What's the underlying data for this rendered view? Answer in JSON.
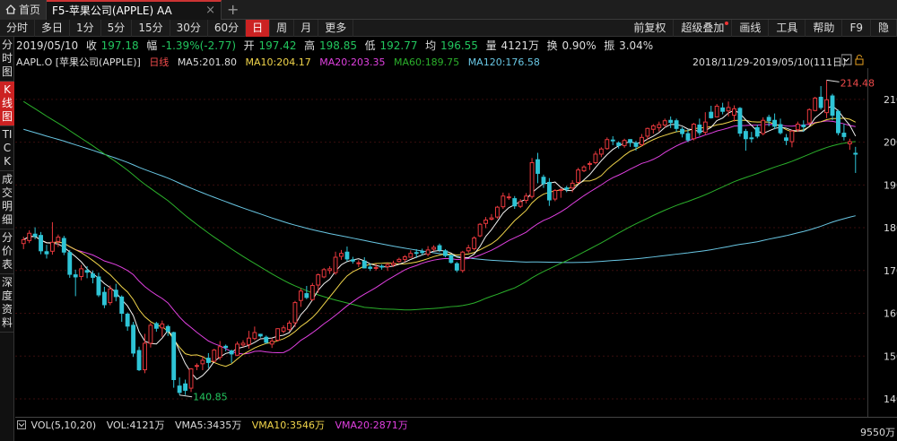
{
  "tabs": {
    "home": "首页",
    "active": "F5-苹果公司(APPLE) AA",
    "close": "×",
    "add": "+"
  },
  "toolbar": {
    "periods": [
      "分时",
      "多日",
      "1分",
      "5分",
      "15分",
      "30分",
      "60分",
      "日",
      "周",
      "月",
      "更多"
    ],
    "active_period": "日",
    "right": [
      "前复权",
      "超级叠加",
      "画线",
      "工具",
      "帮助",
      "F9",
      "隐"
    ]
  },
  "left_tabs": [
    "分时图",
    "K线图",
    "TICK",
    "成交明细",
    "分价表",
    "深度资料"
  ],
  "active_left_tab": "K线图",
  "quote": {
    "date": "2019/05/10",
    "close_label": "收",
    "close": "197.18",
    "change_label": "幅",
    "change": "-1.39%(-2.77)",
    "open_label": "开",
    "open": "197.42",
    "high_label": "高",
    "high": "198.85",
    "low_label": "低",
    "low": "192.77",
    "avg_label": "均",
    "avg": "196.55",
    "vol_label": "量",
    "vol": "4121万",
    "turnover_label": "换",
    "turnover": "0.90%",
    "amp_label": "振",
    "amp": "3.04%"
  },
  "legend": {
    "symbol": "AAPL.O [苹果公司(APPLE)]",
    "period": "日线",
    "ma5": "MA5:201.80",
    "ma10": "MA10:204.17",
    "ma20": "MA20:203.35",
    "ma60": "MA60:189.75",
    "ma120": "MA120:176.58",
    "range": "2018/11/29-2019/05/10(111日)"
  },
  "colors": {
    "up": "#e8383d",
    "down": "#2ec4d6",
    "ma5": "#f2f2f2",
    "ma10": "#f2d64b",
    "ma20": "#e040e0",
    "ma60": "#2bb02b",
    "ma120": "#69c7e4",
    "grid": "#3a0e0e"
  },
  "chart_data": {
    "type": "candlestick",
    "yticks": [
      140,
      150,
      160,
      170,
      180,
      190,
      200,
      210
    ],
    "ylim": [
      135.6,
      217.3
    ],
    "max_label": "214.48",
    "min_label": "140.85",
    "candles": [
      [
        176.3,
        177.2,
        175.0,
        177.9
      ],
      [
        177.0,
        178.7,
        176.4,
        179.4
      ],
      [
        178.5,
        178.0,
        177.3,
        180.1
      ],
      [
        178.2,
        174.6,
        173.8,
        179.0
      ],
      [
        174.4,
        173.9,
        172.8,
        176.0
      ],
      [
        174.5,
        176.6,
        173.7,
        181.3
      ],
      [
        176.8,
        177.8,
        175.5,
        178.4
      ],
      [
        177.5,
        174.3,
        173.6,
        178.1
      ],
      [
        174.2,
        169.1,
        168.3,
        174.8
      ],
      [
        169.0,
        168.5,
        164.0,
        170.2
      ],
      [
        168.6,
        170.4,
        167.7,
        171.3
      ],
      [
        170.0,
        169.6,
        168.2,
        171.0
      ],
      [
        169.2,
        168.4,
        167.0,
        170.0
      ],
      [
        168.5,
        164.3,
        163.8,
        169.5
      ],
      [
        164.9,
        162.0,
        161.2,
        166.2
      ],
      [
        162.5,
        165.7,
        161.9,
        166.5
      ],
      [
        165.4,
        163.9,
        162.8,
        166.9
      ],
      [
        163.8,
        160.0,
        158.0,
        164.2
      ],
      [
        159.8,
        157.0,
        155.9,
        160.2
      ],
      [
        157.2,
        150.7,
        149.8,
        158.0
      ],
      [
        151.3,
        146.8,
        146.5,
        152.2
      ],
      [
        146.8,
        153.0,
        146.0,
        155.2
      ],
      [
        153.0,
        157.2,
        152.0,
        157.8
      ],
      [
        157.6,
        156.5,
        155.7,
        158.0
      ],
      [
        156.6,
        157.5,
        154.5,
        158.3
      ],
      [
        156.9,
        155.8,
        154.7,
        157.3
      ],
      [
        155.5,
        144.5,
        142.6,
        155.7
      ],
      [
        143.0,
        141.5,
        140.9,
        145.0
      ],
      [
        143.5,
        142.0,
        140.9,
        144.5
      ],
      [
        142.5,
        147.0,
        141.6,
        147.2
      ],
      [
        147.6,
        147.8,
        146.7,
        148.3
      ],
      [
        148.2,
        149.0,
        146.7,
        150.0
      ],
      [
        149.5,
        148.5,
        147.2,
        150.7
      ],
      [
        148.8,
        151.4,
        148.6,
        151.7
      ],
      [
        149.7,
        152.2,
        149.1,
        153.5
      ],
      [
        152.3,
        152.0,
        151.1,
        152.7
      ],
      [
        151.2,
        150.5,
        148.4,
        151.5
      ],
      [
        150.2,
        152.8,
        150.0,
        153.4
      ],
      [
        152.6,
        153.0,
        152.1,
        153.7
      ],
      [
        152.7,
        154.2,
        151.7,
        155.9
      ],
      [
        154.1,
        155.5,
        153.7,
        156.9
      ],
      [
        155.1,
        154.7,
        154.3,
        155.2
      ],
      [
        154.4,
        153.2,
        152.9,
        154.8
      ],
      [
        152.8,
        153.5,
        151.9,
        154.2
      ],
      [
        153.7,
        156.4,
        153.4,
        156.5
      ],
      [
        155.8,
        156.6,
        155.3,
        157.2
      ],
      [
        156.2,
        157.7,
        155.8,
        158.3
      ],
      [
        157.8,
        162.5,
        156.8,
        162.9
      ],
      [
        163.0,
        165.2,
        161.5,
        165.8
      ],
      [
        164.6,
        163.7,
        163.3,
        166.4
      ],
      [
        163.2,
        166.5,
        162.9,
        167.1
      ],
      [
        166.6,
        169.0,
        164.8,
        169.3
      ],
      [
        168.5,
        170.2,
        168.2,
        170.6
      ],
      [
        170.0,
        170.4,
        169.2,
        171.0
      ],
      [
        169.5,
        173.1,
        169.0,
        174.4
      ],
      [
        173.3,
        174.0,
        172.5,
        174.8
      ],
      [
        174.3,
        172.7,
        172.1,
        175.6
      ],
      [
        172.5,
        172.2,
        171.6,
        173.2
      ],
      [
        171.7,
        171.8,
        170.8,
        172.4
      ],
      [
        172.2,
        170.6,
        170.5,
        173.1
      ],
      [
        170.8,
        170.5,
        169.9,
        171.6
      ],
      [
        170.7,
        170.7,
        170.0,
        171.5
      ],
      [
        171.0,
        170.9,
        170.2,
        171.4
      ],
      [
        170.9,
        171.4,
        169.9,
        171.8
      ],
      [
        171.3,
        171.7,
        170.8,
        172.3
      ],
      [
        172.1,
        172.6,
        171.8,
        173.0
      ],
      [
        172.6,
        173.2,
        172.0,
        173.6
      ],
      [
        173.1,
        174.0,
        173.0,
        174.7
      ],
      [
        174.2,
        174.1,
        172.9,
        175.0
      ],
      [
        174.4,
        174.3,
        173.6,
        175.1
      ],
      [
        173.8,
        174.8,
        173.3,
        175.7
      ],
      [
        175.0,
        175.4,
        174.5,
        175.9
      ],
      [
        175.8,
        174.8,
        174.3,
        176.3
      ],
      [
        174.6,
        173.5,
        173.1,
        175.0
      ],
      [
        173.5,
        171.9,
        171.6,
        173.8
      ],
      [
        171.6,
        170.1,
        169.6,
        172.0
      ],
      [
        170.0,
        174.3,
        169.5,
        174.6
      ],
      [
        174.6,
        175.3,
        174.1,
        176.0
      ],
      [
        175.1,
        177.6,
        174.7,
        178.0
      ],
      [
        178.1,
        180.8,
        177.8,
        181.1
      ],
      [
        181.0,
        181.8,
        179.9,
        182.5
      ],
      [
        182.0,
        182.3,
        181.7,
        183.2
      ],
      [
        182.5,
        184.8,
        182.1,
        185.1
      ],
      [
        184.9,
        187.4,
        184.4,
        188.2
      ],
      [
        187.2,
        187.2,
        186.5,
        188.1
      ],
      [
        186.8,
        185.1,
        184.4,
        187.4
      ],
      [
        185.0,
        186.1,
        184.6,
        186.7
      ],
      [
        186.4,
        187.4,
        185.7,
        188.1
      ],
      [
        187.3,
        195.2,
        186.8,
        196.3
      ],
      [
        195.9,
        192.7,
        190.4,
        197.5
      ],
      [
        191.8,
        190.3,
        189.3,
        192.4
      ],
      [
        190.6,
        186.5,
        185.1,
        191.6
      ],
      [
        186.7,
        188.7,
        186.2,
        189.0
      ],
      [
        188.8,
        188.9,
        187.0,
        189.3
      ],
      [
        189.3,
        189.0,
        188.3,
        189.8
      ],
      [
        189.3,
        190.4,
        188.3,
        191.1
      ],
      [
        190.6,
        193.5,
        190.2,
        194.0
      ],
      [
        193.3,
        194.2,
        193.0,
        194.6
      ],
      [
        194.8,
        195.0,
        193.5,
        195.5
      ],
      [
        195.2,
        197.2,
        194.8,
        197.9
      ],
      [
        197.2,
        198.4,
        196.5,
        198.8
      ],
      [
        198.5,
        200.6,
        198.2,
        201.1
      ],
      [
        200.5,
        200.3,
        199.3,
        201.4
      ],
      [
        199.8,
        199.2,
        198.5,
        200.2
      ],
      [
        199.2,
        200.4,
        198.7,
        200.8
      ],
      [
        200.6,
        199.9,
        198.9,
        200.7
      ],
      [
        199.8,
        199.0,
        198.0,
        200.3
      ],
      [
        199.4,
        201.1,
        199.0,
        201.9
      ],
      [
        201.4,
        203.2,
        200.5,
        203.4
      ],
      [
        203.0,
        203.8,
        202.0,
        204.2
      ],
      [
        203.4,
        204.1,
        202.5,
        204.8
      ],
      [
        204.0,
        205.0,
        203.4,
        205.5
      ],
      [
        205.1,
        204.6,
        203.3,
        206.0
      ],
      [
        205.0,
        203.2,
        202.4,
        205.5
      ],
      [
        203.0,
        202.0,
        201.1,
        203.5
      ],
      [
        202.0,
        200.5,
        200.0,
        203.0
      ],
      [
        200.8,
        204.2,
        200.4,
        204.5
      ],
      [
        204.0,
        202.2,
        201.5,
        205.5
      ],
      [
        202.3,
        204.7,
        201.7,
        207.0
      ],
      [
        207.0,
        205.7,
        205.5,
        208.5
      ],
      [
        205.9,
        208.4,
        205.8,
        208.9
      ],
      [
        208.0,
        207.2,
        206.5,
        209.2
      ],
      [
        207.3,
        208.1,
        206.0,
        209.5
      ],
      [
        206.3,
        207.8,
        204.8,
        208.6
      ],
      [
        207.9,
        202.1,
        201.3,
        208.2
      ],
      [
        202.5,
        200.8,
        198.0,
        203.1
      ],
      [
        201.0,
        200.8,
        199.9,
        202.4
      ],
      [
        203.4,
        201.4,
        200.9,
        204.1
      ],
      [
        202.0,
        205.1,
        201.6,
        205.8
      ],
      [
        205.8,
        205.0,
        203.7,
        206.4
      ],
      [
        205.1,
        203.7,
        203.0,
        206.7
      ],
      [
        204.1,
        202.2,
        201.8,
        205.5
      ],
      [
        201.0,
        200.4,
        199.3,
        201.9
      ],
      [
        200.1,
        202.6,
        198.8,
        202.9
      ],
      [
        202.9,
        204.2,
        202.4,
        204.8
      ],
      [
        204.0,
        203.6,
        202.4,
        205.1
      ],
      [
        204.5,
        207.6,
        203.9,
        207.9
      ],
      [
        207.4,
        210.3,
        207.2,
        210.6
      ],
      [
        210.5,
        208.1,
        207.6,
        213.1
      ],
      [
        206.9,
        209.9,
        205.6,
        214.5
      ],
      [
        210.8,
        206.3,
        205.1,
        211.3
      ],
      [
        207.2,
        202.2,
        201.6,
        207.6
      ],
      [
        202.1,
        201.3,
        200.4,
        204.3
      ],
      [
        199.6,
        200.1,
        198.2,
        200.8
      ],
      [
        197.4,
        197.2,
        192.8,
        198.9
      ]
    ]
  },
  "volume": {
    "params": "VOL(5,10,20)",
    "vol": "VOL:4121万",
    "vma5": "VMA5:3435万",
    "vma10": "VMA10:3546万",
    "vma20": "VMA20:2871万",
    "axis_label": "9550万"
  }
}
